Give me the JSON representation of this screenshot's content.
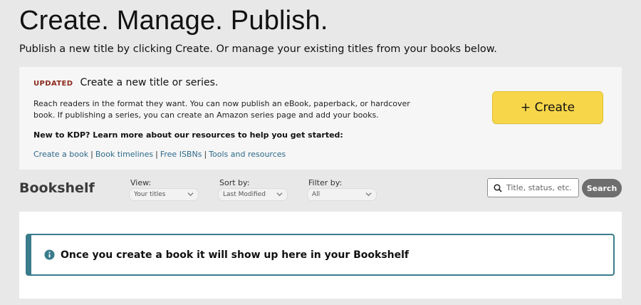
{
  "hero": {
    "title": "Create. Manage. Publish.",
    "subtitle": "Publish a new title by clicking Create. Or manage your existing titles from your books below."
  },
  "create_panel": {
    "badge": "UPDATED",
    "heading": "Create a new title or series.",
    "description": "Reach readers in the format they want. You can now publish an eBook, paperback, or hardcover book. If publishing a series, you can create an Amazon series page and add your books.",
    "new_to_kdp": "New to KDP? Learn more about our resources to help you get started:",
    "links": [
      "Create a book",
      "Book timelines",
      "Free ISBNs",
      "Tools and resources"
    ],
    "link_separator": "|",
    "create_button": "+ Create"
  },
  "bookshelf": {
    "title": "Bookshelf",
    "view": {
      "label": "View:",
      "value": "Your titles"
    },
    "sort": {
      "label": "Sort by:",
      "value": "Last Modified"
    },
    "filter": {
      "label": "Filter by:",
      "value": "All"
    },
    "search": {
      "placeholder": "Title, status, etc.",
      "button": "Search"
    },
    "empty_message": "Once you create a book it will show up here in your Bookshelf"
  },
  "icons": {
    "search": "search-icon",
    "chevron": "chevron-down-icon",
    "info": "info-icon"
  },
  "colors": {
    "create_button": "#f7d64a",
    "badge": "#8b2a1a",
    "link": "#2d6a8a",
    "alert_border": "#3a7c8c",
    "search_button": "#6e6e6e"
  }
}
